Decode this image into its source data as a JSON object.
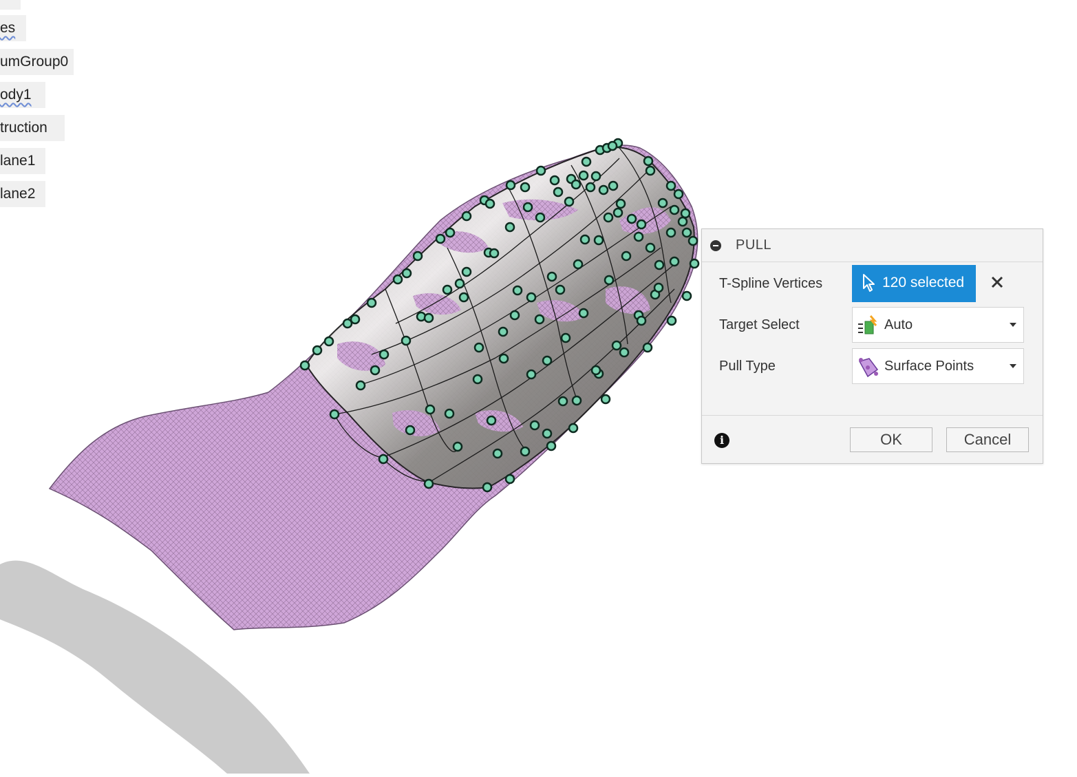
{
  "browser": {
    "items": [
      {
        "label": "es"
      },
      {
        "label": "umGroup0"
      },
      {
        "label": "ody1"
      },
      {
        "label": "truction"
      },
      {
        "label": "lane1"
      },
      {
        "label": "lane2"
      }
    ]
  },
  "pull_dialog": {
    "title": "PULL",
    "rows": {
      "vertices": {
        "label": "T-Spline Vertices",
        "value": "120 selected"
      },
      "target_select": {
        "label": "Target Select",
        "value": "Auto"
      },
      "pull_type": {
        "label": "Pull Type",
        "value": "Surface Points"
      }
    },
    "ok_label": "OK",
    "cancel_label": "Cancel"
  },
  "colors": {
    "selection_accent": "#1b8bd6",
    "mesh": "#cfa6d8",
    "tspline_surface": "#8d8d87",
    "control_vertex": "#79d3b0"
  },
  "icons": [
    "collapse-icon",
    "cursor-icon",
    "clear-icon",
    "target-select-icon",
    "surface-points-icon",
    "info-icon",
    "chevron-down-icon"
  ]
}
